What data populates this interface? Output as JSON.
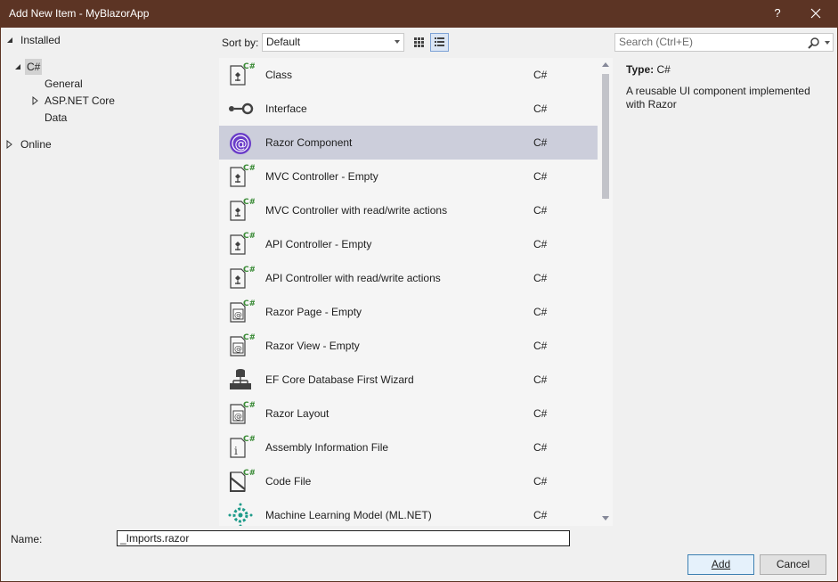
{
  "window": {
    "title": "Add New Item - MyBlazorApp",
    "help_label": "?"
  },
  "tree": {
    "installed": "Installed",
    "csharp": "C#",
    "general": "General",
    "aspnetcore": "ASP.NET Core",
    "data": "Data",
    "online": "Online"
  },
  "toolbar": {
    "sort_label": "Sort by:",
    "sort_value": "Default",
    "search_placeholder": "Search (Ctrl+E)"
  },
  "templates": [
    {
      "name": "Class",
      "lang": "C#",
      "icon": "class-file-icon"
    },
    {
      "name": "Interface",
      "lang": "C#",
      "icon": "interface-icon"
    },
    {
      "name": "Razor Component",
      "lang": "C#",
      "icon": "blazor-icon"
    },
    {
      "name": "MVC Controller - Empty",
      "lang": "C#",
      "icon": "class-file-icon"
    },
    {
      "name": "MVC Controller with read/write actions",
      "lang": "C#",
      "icon": "class-file-icon"
    },
    {
      "name": "API Controller - Empty",
      "lang": "C#",
      "icon": "class-file-icon"
    },
    {
      "name": "API Controller with read/write actions",
      "lang": "C#",
      "icon": "class-file-icon"
    },
    {
      "name": "Razor Page - Empty",
      "lang": "C#",
      "icon": "razor-file-icon"
    },
    {
      "name": "Razor View - Empty",
      "lang": "C#",
      "icon": "razor-file-icon"
    },
    {
      "name": "EF Core Database First Wizard",
      "lang": "C#",
      "icon": "database-icon"
    },
    {
      "name": "Razor Layout",
      "lang": "C#",
      "icon": "razor-file-icon"
    },
    {
      "name": "Assembly Information File",
      "lang": "C#",
      "icon": "info-file-icon"
    },
    {
      "name": "Code File",
      "lang": "C#",
      "icon": "code-file-icon"
    },
    {
      "name": "Machine Learning Model (ML.NET)",
      "lang": "C#",
      "icon": "ml-icon"
    }
  ],
  "selected_template": "Razor Component",
  "info": {
    "type_label": "Type:",
    "type_value": "C#",
    "description": "A reusable UI component implemented with Razor"
  },
  "footer": {
    "name_label": "Name:",
    "name_value": "_Imports.razor",
    "add_label": "Add",
    "cancel_label": "Cancel"
  },
  "colors": {
    "titlebar": "#5c3424",
    "selected_row": "#cccedb",
    "csharp_green": "#388a34",
    "blazor_purple": "#6a3cc8"
  }
}
